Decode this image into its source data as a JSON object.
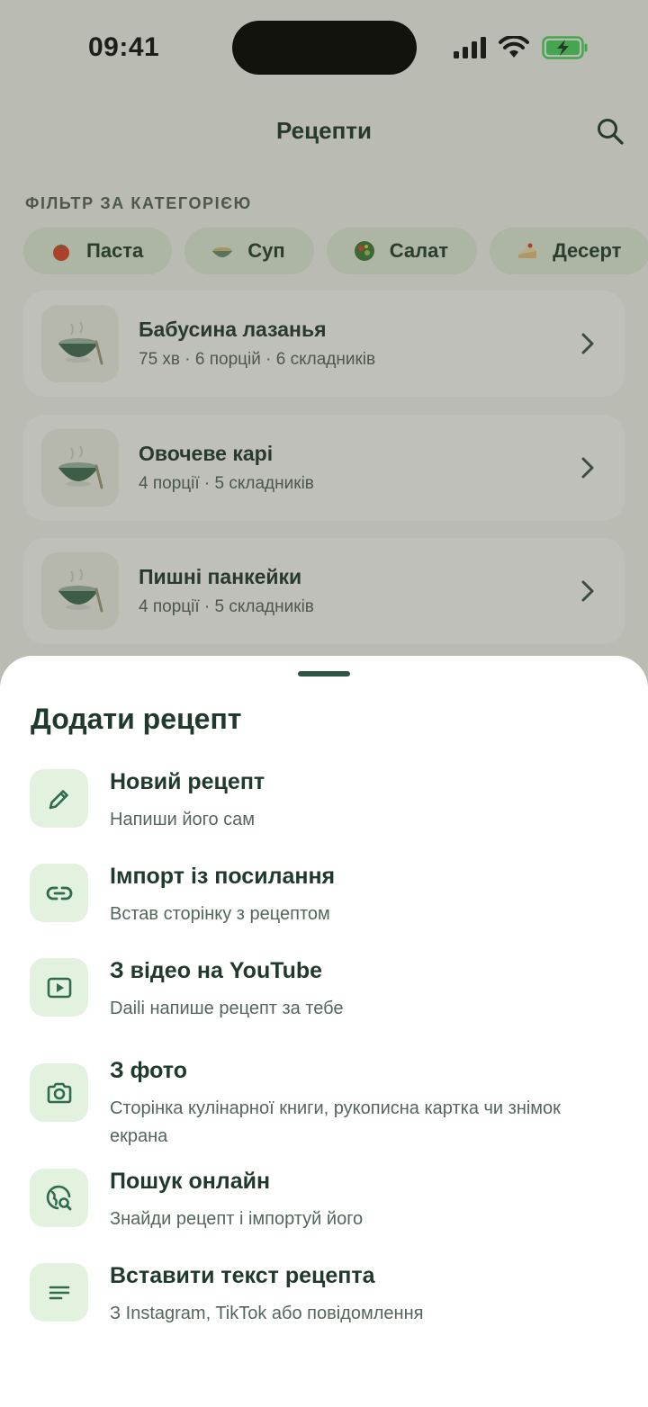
{
  "status_bar": {
    "time": "09:41"
  },
  "header": {
    "title": "Рецепти"
  },
  "filter": {
    "label": "ФІЛЬТР ЗА КАТЕГОРІЄЮ",
    "chips": [
      {
        "label": "Паста",
        "icon": "tomato-icon"
      },
      {
        "label": "Суп",
        "icon": "soup-bowl-icon"
      },
      {
        "label": "Салат",
        "icon": "salad-icon"
      },
      {
        "label": "Десерт",
        "icon": "cake-icon"
      }
    ]
  },
  "recipes": [
    {
      "name": "Бабусина лазанья",
      "meta": "75 хв · 6 порцій · 6 складників"
    },
    {
      "name": "Овочеве карі",
      "meta": "4 порції · 5 складників"
    },
    {
      "name": "Пишні панкейки",
      "meta": "4 порції · 5 складників"
    }
  ],
  "sheet": {
    "title": "Додати рецепт",
    "options": [
      {
        "title": "Новий рецепт",
        "subtitle": "Напиши його сам",
        "icon": "pencil-icon"
      },
      {
        "title": "Імпорт із посилання",
        "subtitle": "Встав сторінку з рецептом",
        "icon": "link-icon"
      },
      {
        "title": "З відео на YouTube",
        "subtitle": "Daili напише рецепт за тебе",
        "icon": "video-play-icon"
      },
      {
        "title": "З фото",
        "subtitle": "Сторінка кулінарної книги, рукописна картка чи знімок екрана",
        "icon": "camera-icon"
      },
      {
        "title": "Пошук онлайн",
        "subtitle": "Знайди рецепт і імпортуй його",
        "icon": "globe-search-icon"
      },
      {
        "title": "Вставити текст рецепта",
        "subtitle": "З Instagram, TikTok або повідомлення",
        "icon": "text-lines-icon"
      }
    ]
  },
  "colors": {
    "primary": "#1f3a2d",
    "icon_green": "#2f6b4d",
    "chip_bg": "#e3efdf",
    "highlight_border": "#d9a33a",
    "battery": "#4cd964"
  }
}
